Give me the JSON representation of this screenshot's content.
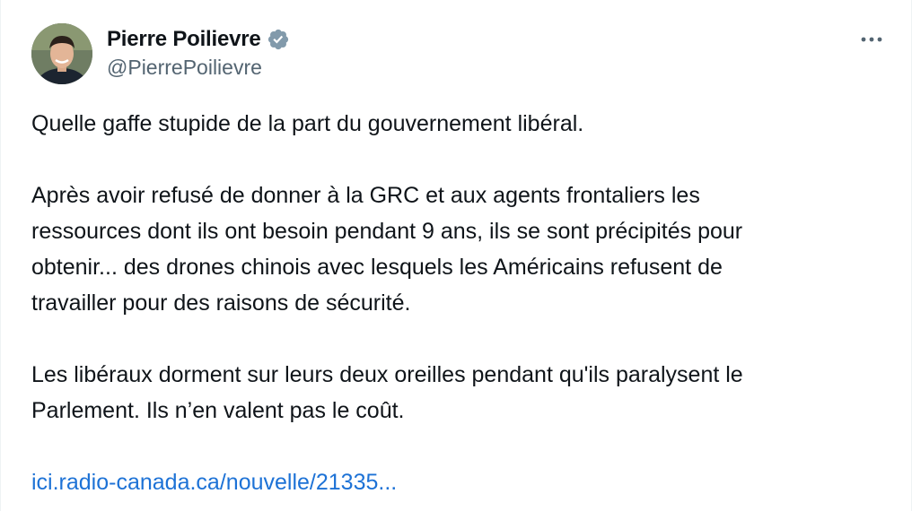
{
  "post": {
    "author": {
      "display_name": "Pierre Poilievre",
      "handle": "@PierrePoilievre",
      "verified_icon": "verified-badge-icon",
      "avatar_icon": "avatar"
    },
    "more_icon": "more-horizontal-icon",
    "text": {
      "p1_l1": "Quelle gaffe stupide de la part du gouvernement libéral.",
      "p2_l1": "Après avoir refusé de donner à la GRC et aux agents frontaliers les",
      "p2_l2": "ressources dont ils ont besoin pendant 9 ans, ils se sont précipités pour",
      "p2_l3": "obtenir... des drones chinois avec lesquels les Américains refusent de",
      "p2_l4": "travailler pour des raisons de sécurité.",
      "p3_l1": "Les libéraux dorment sur leurs deux oreilles pendant qu'ils paralysent le",
      "p3_l2": "Parlement. Ils n’en valent pas le coût."
    },
    "link": "ici.radio-canada.ca/nouvelle/21335..."
  },
  "colors": {
    "text": "#0f1419",
    "secondary": "#536471",
    "link": "#1d72d6",
    "verified_badge": "#829aab"
  }
}
